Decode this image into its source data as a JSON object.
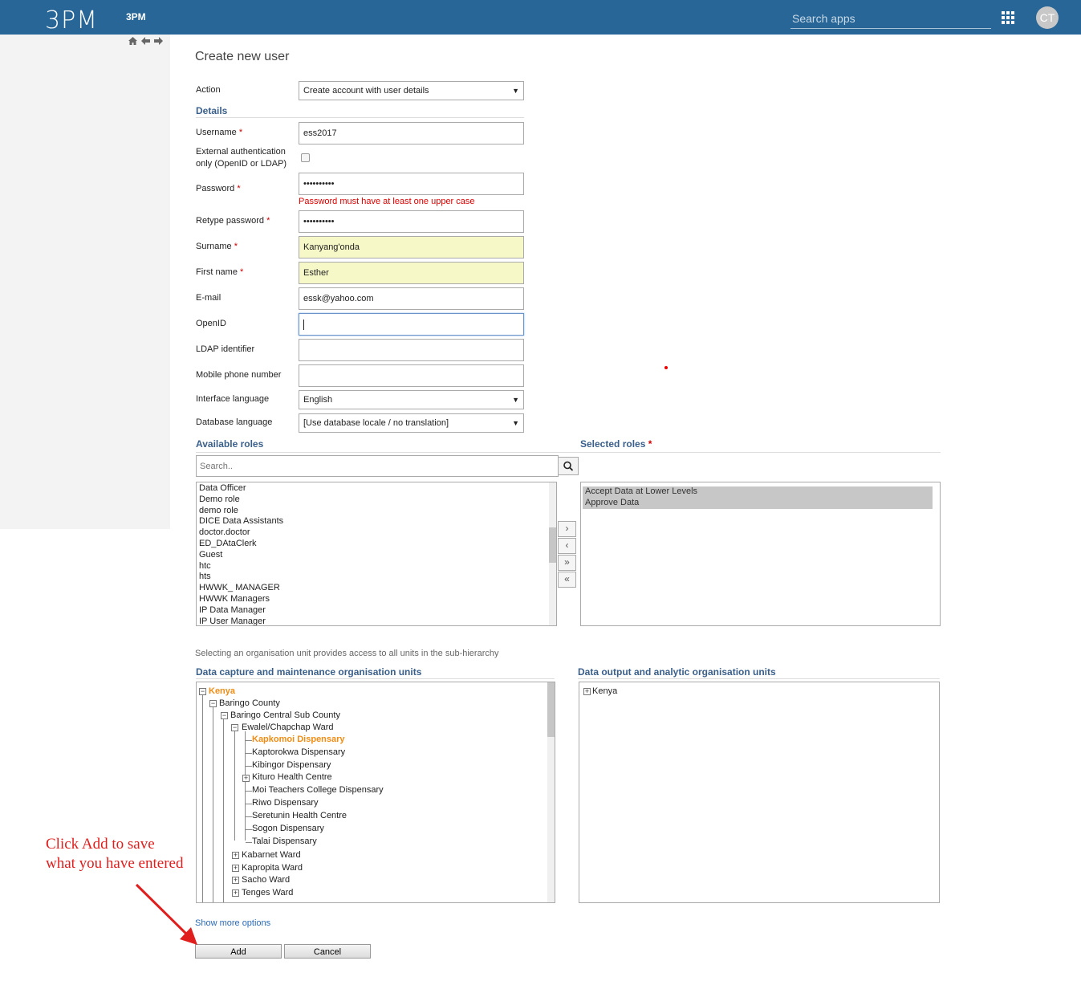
{
  "header": {
    "logo": "3PM",
    "brand": "3PM",
    "search_placeholder": "Search apps",
    "avatar_initials": "CT"
  },
  "page_title": "Create new user",
  "form": {
    "action_label": "Action",
    "action_value": "Create account with user details",
    "details_heading": "Details",
    "username_label": "Username",
    "username_value": "ess2017",
    "external_auth_label_1": "External authentication",
    "external_auth_label_2": "only (OpenID or LDAP)",
    "password_label": "Password",
    "password_value": "••••••••••",
    "password_error": "Password must have at least one upper case",
    "retype_label": "Retype password",
    "retype_value": "••••••••••",
    "surname_label": "Surname",
    "surname_value": "Kanyang'onda",
    "firstname_label": "First name",
    "firstname_value": "Esther",
    "email_label": "E-mail",
    "email_value": "essk@yahoo.com",
    "openid_label": "OpenID",
    "openid_value": "",
    "ldap_label": "LDAP identifier",
    "ldap_value": "",
    "mobile_label": "Mobile phone number",
    "mobile_value": "",
    "ui_lang_label": "Interface language",
    "ui_lang_value": "English",
    "db_lang_label": "Database language",
    "db_lang_value": "[Use database locale / no translation]",
    "required_mark": "*"
  },
  "roles": {
    "available_heading": "Available roles",
    "selected_heading": "Selected roles",
    "search_placeholder": "Search..",
    "available": [
      "Data Officer",
      "Demo role",
      "demo role",
      "DICE Data Assistants",
      "doctor.doctor",
      "ED_DAtaClerk",
      "Guest",
      "htc",
      "hts",
      "HWWK_ MANAGER",
      "HWWK Managers",
      "IP Data Manager",
      "IP User Manager"
    ],
    "selected": [
      "Accept Data at Lower Levels",
      "Approve Data"
    ],
    "move_right": "›",
    "move_left": "‹",
    "move_all_right": "»",
    "move_all_left": "«"
  },
  "org": {
    "note": "Selecting an organisation unit provides access to all units in the sub-hierarchy",
    "capture_heading": "Data capture and maintenance organisation units",
    "output_heading": "Data output and analytic organisation units",
    "tree": {
      "kenya": "Kenya",
      "baringo_county": "Baringo County",
      "baringo_central": "Baringo Central Sub County",
      "ewalel": "Ewalel/Chapchap Ward",
      "kapkomoi": "Kapkomoi Dispensary",
      "kaptorokwa": "Kaptorokwa Dispensary",
      "kibingor": "Kibingor Dispensary",
      "kituro": "Kituro Health Centre",
      "moi_teachers": "Moi Teachers College Dispensary",
      "riwo": "Riwo Dispensary",
      "seretunin": "Seretunin Health Centre",
      "sogon": "Sogon Dispensary",
      "talai": "Talai Dispensary",
      "kabarnet": "Kabarnet Ward",
      "kapropita": "Kapropita Ward",
      "sacho": "Sacho Ward",
      "tenges": "Tenges Ward"
    },
    "output_tree": {
      "kenya": "Kenya"
    }
  },
  "actions": {
    "show_more": "Show more options",
    "add": "Add",
    "cancel": "Cancel"
  },
  "annotation": {
    "line1": "Click Add to save",
    "line2": "what you have entered",
    "color": "#e01e1e"
  }
}
